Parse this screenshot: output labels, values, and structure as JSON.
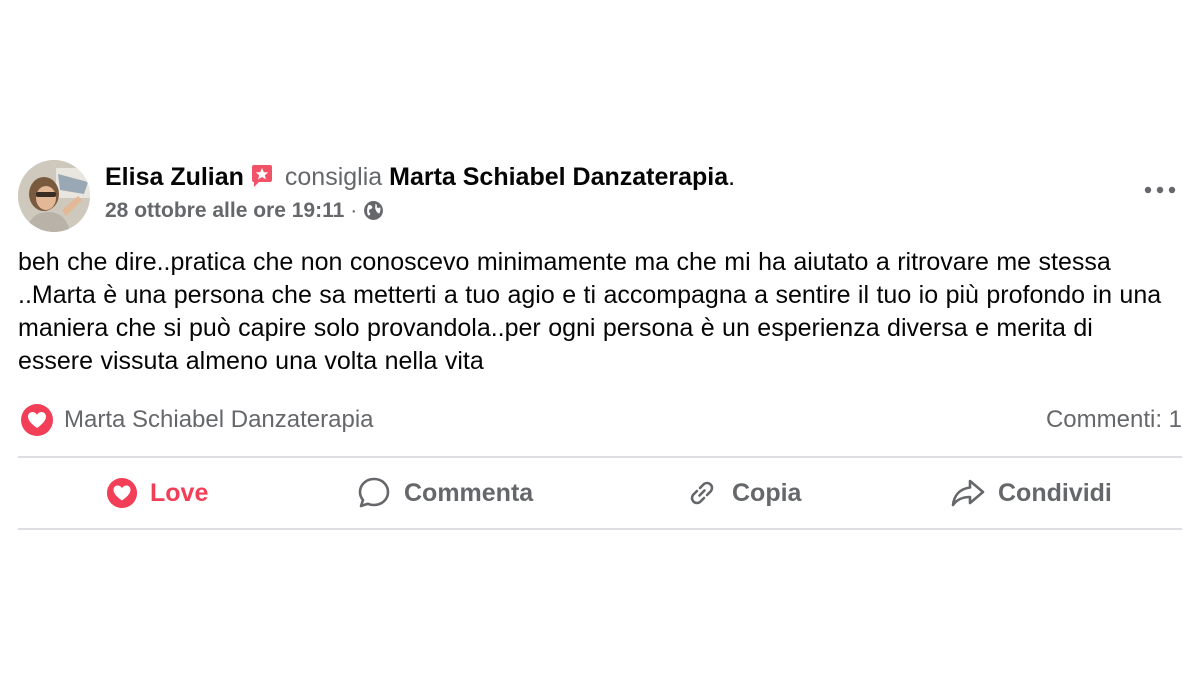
{
  "post": {
    "author": "Elisa Zulian",
    "verb": "consiglia",
    "page": "Marta Schiabel Danzaterapia",
    "period": ".",
    "timestamp": "28 ottobre alle ore 19:11",
    "separator": "·",
    "privacy_icon": "globe-icon",
    "text": "beh che dire..pratica che non conoscevo minimamente ma che mi ha aiutato a ritrovare me stessa ..Marta è una persona che sa metterti a tuo agio e ti accompagna a sentire il tuo io più profondo in una maniera che si può capire solo provandola..per ogni persona è un esperienza diversa e merita di essere vissuta almeno una volta nella vita"
  },
  "stats": {
    "reaction_icon": "heart-icon",
    "reacted_by": "Marta Schiabel Danzaterapia",
    "comments": "Commenti: 1"
  },
  "actions": {
    "love": "Love",
    "comment": "Commenta",
    "copy": "Copia",
    "share": "Condividi"
  },
  "colors": {
    "love_accent": "#f33e58",
    "secondary_text": "#65676b",
    "primary_text": "#050505",
    "divider": "#dcdee2"
  }
}
